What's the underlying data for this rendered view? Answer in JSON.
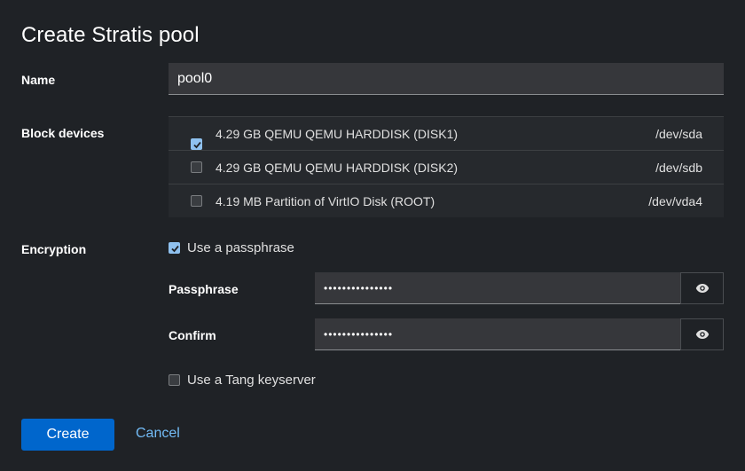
{
  "dialog": {
    "title": "Create Stratis pool"
  },
  "name": {
    "label": "Name",
    "value": "pool0"
  },
  "block_devices": {
    "label": "Block devices",
    "items": [
      {
        "name": "4.29 GB QEMU QEMU HARDDISK (DISK1)",
        "path": "/dev/sda",
        "checked": true
      },
      {
        "name": "4.29 GB QEMU QEMU HARDDISK (DISK2)",
        "path": "/dev/sdb",
        "checked": false
      },
      {
        "name": "4.19 MB Partition of VirtIO Disk (ROOT)",
        "path": "/dev/vda4",
        "checked": false
      }
    ]
  },
  "encryption": {
    "label": "Encryption",
    "use_passphrase": {
      "label": "Use a passphrase",
      "checked": true
    },
    "passphrase": {
      "label": "Passphrase",
      "value": "•••••••••••••••"
    },
    "confirm": {
      "label": "Confirm",
      "value": "•••••••••••••••"
    },
    "use_tang": {
      "label": "Use a Tang keyserver",
      "checked": false
    }
  },
  "footer": {
    "create_label": "Create",
    "cancel_label": "Cancel"
  },
  "colors": {
    "primary": "#0066cc",
    "link": "#73bcf7",
    "checkbox_on": "#8fc1ef",
    "background": "#1f2226"
  },
  "icons": {
    "show_password": "eye-icon",
    "check": "checkmark-icon"
  }
}
